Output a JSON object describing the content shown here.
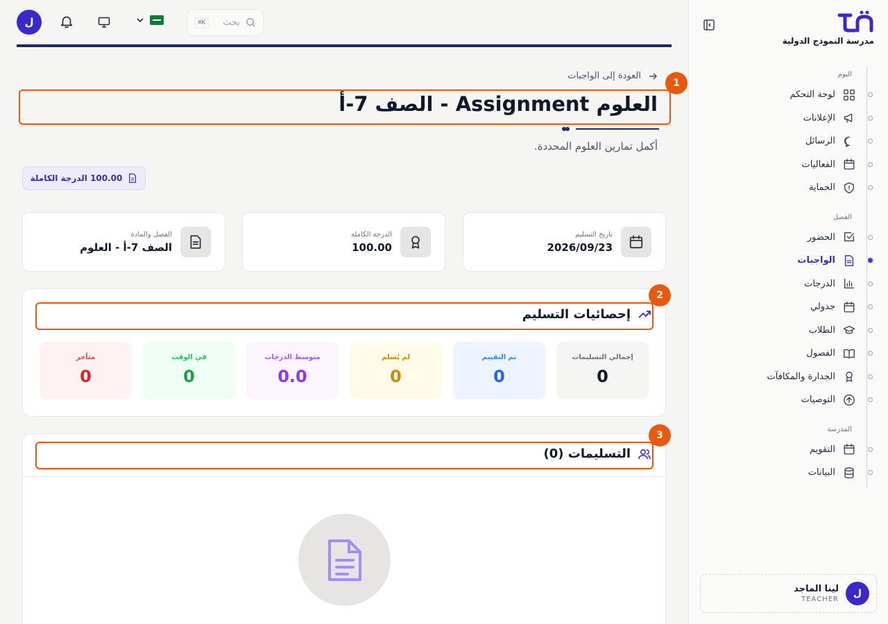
{
  "sidebar": {
    "school_name": "مدرسة النموذج الدولية",
    "sections": [
      {
        "title": "اليوم",
        "items": [
          {
            "label": "لوحة التحكم",
            "icon": "dashboard-icon"
          },
          {
            "label": "الإعلانات",
            "icon": "megaphone-icon"
          },
          {
            "label": "الرسائل",
            "icon": "message-icon"
          },
          {
            "label": "الفعاليات",
            "icon": "calendar-icon"
          },
          {
            "label": "الحماية",
            "icon": "shield-icon"
          }
        ]
      },
      {
        "title": "الفصل",
        "items": [
          {
            "label": "الحضور",
            "icon": "checkbox-icon"
          },
          {
            "label": "الواجبات",
            "icon": "document-icon",
            "active": true
          },
          {
            "label": "الدرجات",
            "icon": "bar-chart-icon"
          },
          {
            "label": "جدولي",
            "icon": "calendar-icon"
          },
          {
            "label": "الطلاب",
            "icon": "graduation-cap-icon"
          },
          {
            "label": "الفصول",
            "icon": "book-icon"
          },
          {
            "label": "الجدارة والمكافآت",
            "icon": "award-icon"
          },
          {
            "label": "التوصيات",
            "icon": "arrow-up-circle-icon"
          }
        ]
      },
      {
        "title": "المدرسة",
        "items": [
          {
            "label": "التقويم",
            "icon": "calendar-icon"
          },
          {
            "label": "البيانات",
            "icon": "database-icon"
          }
        ]
      }
    ],
    "user": {
      "initial": "ل",
      "name": "لينا الماجد",
      "role": "TEACHER"
    }
  },
  "topbar": {
    "avatar_initial": "ل",
    "search_placeholder": "بحث",
    "search_shortcut": "K⌘"
  },
  "main": {
    "back_link": "العودة إلى الواجبات",
    "title": "العلوم Assignment - الصف 7-أ",
    "subtitle": "أكمل تمارين العلوم المحددة.",
    "grade_chip": "100.00 الدرجة الكاملة",
    "info_cards": [
      {
        "label": "تاريخ التسليم",
        "value": "2026/09/23",
        "icon": "calendar-icon"
      },
      {
        "label": "الدرجة الكاملة",
        "value": "100.00",
        "icon": "award-icon"
      },
      {
        "label": "الفصل والمادة",
        "value": "الصف 7-أ - العلوم",
        "icon": "document-icon"
      }
    ],
    "stats": {
      "title": "إحصائيات التسليم",
      "items": [
        {
          "label": "إجمالي التسليمات",
          "value": "0",
          "bg": "#f5f5f4",
          "label_color": "#6b7280",
          "value_color": "#111827"
        },
        {
          "label": "تم التقييم",
          "value": "0",
          "bg": "#eef4ff",
          "label_color": "#3b82f6",
          "value_color": "#2563eb"
        },
        {
          "label": "لم يُسلم",
          "value": "0",
          "bg": "#fefce8",
          "label_color": "#ca8a04",
          "value_color": "#ca8a04"
        },
        {
          "label": "متوسط الدرجات",
          "value": "0.0",
          "bg": "#faf5ff",
          "label_color": "#a855f7",
          "value_color": "#9333ea"
        },
        {
          "label": "في الوقت",
          "value": "0",
          "bg": "#f0fdf4",
          "label_color": "#22c55e",
          "value_color": "#16a34a"
        },
        {
          "label": "متأخر",
          "value": "0",
          "bg": "#fef2f2",
          "label_color": "#ef4444",
          "value_color": "#dc2626"
        }
      ]
    },
    "submissions": {
      "title": "التسليمات (0)"
    }
  },
  "markers": [
    "1",
    "2",
    "3"
  ]
}
